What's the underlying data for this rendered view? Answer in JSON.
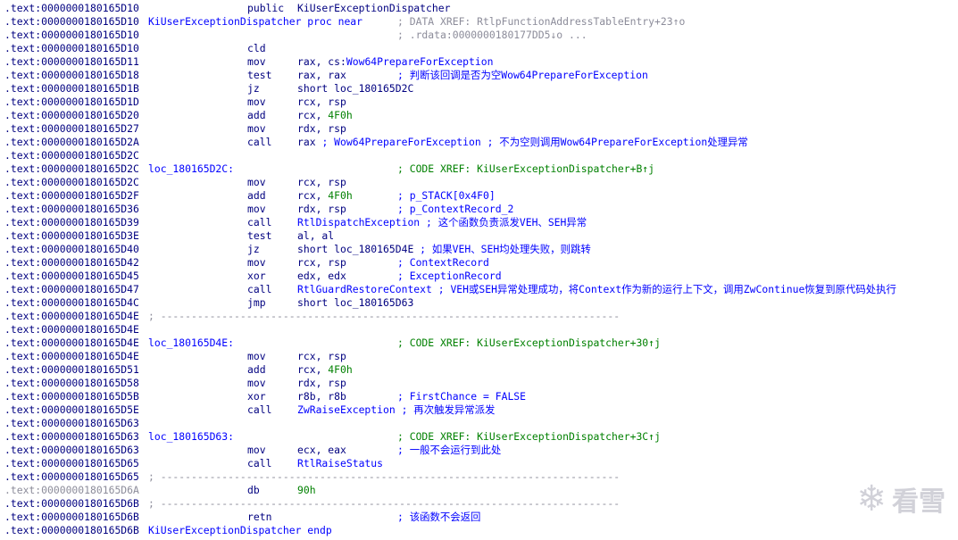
{
  "listing": [
    {
      "addr": ".text:0000000180165D10",
      "hl": true,
      "mnem": "public",
      "ops": "KiUserExceptionDispatcher"
    },
    {
      "addr": ".text:0000000180165D10",
      "label": "KiUserExceptionDispatcher proc near",
      "cmt": "; DATA XREF: RtlpFunctionAddressTableEntry+23↑o",
      "cmt_style": "gray"
    },
    {
      "addr": ".text:0000000180165D10",
      "cmt": "; .rdata:0000000180177DD5↓o ...",
      "cmt_style": "gray"
    },
    {
      "addr": ".text:0000000180165D10",
      "mnem": "cld"
    },
    {
      "addr": ".text:0000000180165D11",
      "mnem": "mov",
      "ops": "rax, cs:",
      "ops_fn": "Wow64PrepareForException"
    },
    {
      "addr": ".text:0000000180165D18",
      "mnem": "test",
      "ops": "rax, rax",
      "cmt": "; 判断该回调是否为空Wow64PrepareForException",
      "cmt_style": "blue"
    },
    {
      "addr": ".text:0000000180165D1B",
      "mnem": "jz",
      "ops": "short loc_180165D2C"
    },
    {
      "addr": ".text:0000000180165D1D",
      "mnem": "mov",
      "ops": "rcx, rsp"
    },
    {
      "addr": ".text:0000000180165D20",
      "mnem": "add",
      "ops": "rcx, ",
      "ops_num": "4F0h"
    },
    {
      "addr": ".text:0000000180165D27",
      "mnem": "mov",
      "ops": "rdx, rsp"
    },
    {
      "addr": ".text:0000000180165D2A",
      "mnem": "call",
      "ops": "rax ",
      "ops_cmt": "; Wow64PrepareForException ; 不为空则调用Wow64PrepareForException处理异常"
    },
    {
      "addr": ".text:0000000180165D2C"
    },
    {
      "addr": ".text:0000000180165D2C",
      "label": "loc_180165D2C:",
      "cmt": "; CODE XREF: KiUserExceptionDispatcher+B↑j",
      "cmt_style": "green"
    },
    {
      "addr": ".text:0000000180165D2C",
      "mnem": "mov",
      "ops": "rcx, rsp"
    },
    {
      "addr": ".text:0000000180165D2F",
      "mnem": "add",
      "ops": "rcx, ",
      "ops_num": "4F0h",
      "cmt": "; p_STACK[0x4F0]",
      "cmt_style": "blue"
    },
    {
      "addr": ".text:0000000180165D36",
      "mnem": "mov",
      "ops": "rdx, rsp",
      "cmt": "; p_ContextRecord_2",
      "cmt_style": "blue"
    },
    {
      "addr": ".text:0000000180165D39",
      "mnem": "call",
      "ops_fn": "RtlDispatchException",
      "ops_cmt": " ; 这个函数负责派发VEH、SEH异常"
    },
    {
      "addr": ".text:0000000180165D3E",
      "mnem": "test",
      "ops": "al, al"
    },
    {
      "addr": ".text:0000000180165D40",
      "mnem": "jz",
      "ops": "short loc_180165D4E",
      "ops_cmt": " ; 如果VEH、SEH均处理失败，则跳转"
    },
    {
      "addr": ".text:0000000180165D42",
      "mnem": "mov",
      "ops": "rcx, rsp",
      "cmt": "; ContextRecord",
      "cmt_style": "blue"
    },
    {
      "addr": ".text:0000000180165D45",
      "mnem": "xor",
      "ops": "edx, edx",
      "cmt": "; ExceptionRecord",
      "cmt_style": "blue"
    },
    {
      "addr": ".text:0000000180165D47",
      "mnem": "call",
      "ops_fn": "RtlGuardRestoreContext",
      "ops_cmt": " ; VEH或SEH异常处理成功，将Context作为新的运行上下文，调用ZwContinue恢复到原代码处执行"
    },
    {
      "addr": ".text:0000000180165D4C",
      "mnem": "jmp",
      "ops": "short loc_180165D63"
    },
    {
      "addr": ".text:0000000180165D4E",
      "sep": "; ---------------------------------------------------------------------------"
    },
    {
      "addr": ".text:0000000180165D4E"
    },
    {
      "addr": ".text:0000000180165D4E",
      "label": "loc_180165D4E:",
      "cmt": "; CODE XREF: KiUserExceptionDispatcher+30↑j",
      "cmt_style": "green"
    },
    {
      "addr": ".text:0000000180165D4E",
      "mnem": "mov",
      "ops": "rcx, rsp"
    },
    {
      "addr": ".text:0000000180165D51",
      "mnem": "add",
      "ops": "rcx, ",
      "ops_num": "4F0h"
    },
    {
      "addr": ".text:0000000180165D58",
      "mnem": "mov",
      "ops": "rdx, rsp"
    },
    {
      "addr": ".text:0000000180165D5B",
      "mnem": "xor",
      "ops": "r8b, r8b",
      "cmt": "; FirstChance = FALSE",
      "cmt_style": "blue"
    },
    {
      "addr": ".text:0000000180165D5E",
      "mnem": "call",
      "ops_fn": "ZwRaiseException",
      "ops_cmt": " ; 再次触发异常派发"
    },
    {
      "addr": ".text:0000000180165D63"
    },
    {
      "addr": ".text:0000000180165D63",
      "label": "loc_180165D63:",
      "cmt": "; CODE XREF: KiUserExceptionDispatcher+3C↑j",
      "cmt_style": "green"
    },
    {
      "addr": ".text:0000000180165D63",
      "mnem": "mov",
      "ops": "ecx, eax",
      "cmt": "; 一般不会运行到此处",
      "cmt_style": "blue"
    },
    {
      "addr": ".text:0000000180165D65",
      "mnem": "call",
      "ops_fn": "RtlRaiseStatus"
    },
    {
      "addr": ".text:0000000180165D65",
      "sep": "; ---------------------------------------------------------------------------"
    },
    {
      "addr": ".text:0000000180165D6A",
      "addr_style": "gray",
      "mnem": "db",
      "ops_num": "90h"
    },
    {
      "addr": ".text:0000000180165D6B",
      "sep": "; ---------------------------------------------------------------------------"
    },
    {
      "addr": ".text:0000000180165D6B",
      "mnem": "retn",
      "cmt": "; 该函数不会返回",
      "cmt_style": "blue"
    },
    {
      "addr": ".text:0000000180165D6B",
      "label": "KiUserExceptionDispatcher endp"
    }
  ],
  "watermark": {
    "text": "看雪",
    "icon": "snowflake-icon",
    "glyph": "❄"
  },
  "colors": {
    "address": "#000080",
    "label": "#0000ff",
    "comment_xref": "#008000",
    "comment_gray": "#8c8c9a",
    "highlight": "#e0ecff"
  }
}
